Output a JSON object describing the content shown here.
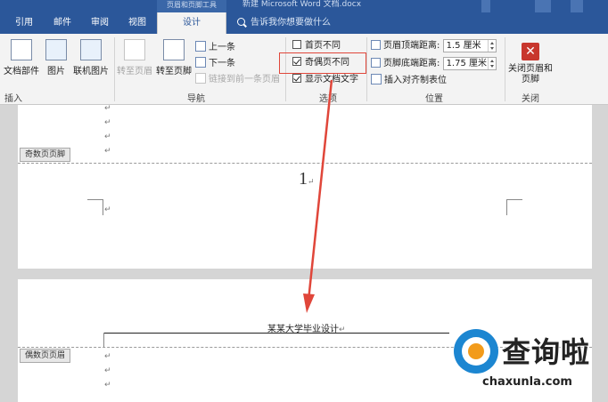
{
  "titlebar": {
    "context_group": "页眉和页脚工具",
    "doc_title": "新建 Microsoft Word 文档.docx",
    "tabs": [
      "引用",
      "邮件",
      "审阅",
      "视图",
      "设计"
    ],
    "active_tab": "设计",
    "tell_me": "告诉我你想要做什么"
  },
  "ribbon": {
    "insert": {
      "doc_parts": "文档部件",
      "picture": "图片",
      "online_picture": "联机图片",
      "label": "插入"
    },
    "nav": {
      "goto_header": "转至页眉",
      "goto_footer": "转至页脚",
      "previous": "上一条",
      "next": "下一条",
      "link_prev": "链接到前一条页眉",
      "label": "导航"
    },
    "options": {
      "diff_first": "首页不同",
      "diff_odd_even": "奇偶页不同",
      "show_doc_text": "显示文档文字",
      "label": "选项"
    },
    "position": {
      "header_top": "页眉顶端距离:",
      "header_top_value": "1.5 厘米",
      "footer_bottom": "页脚底端距离:",
      "footer_bottom_value": "1.75 厘米",
      "align_tab": "插入对齐制表位",
      "label": "位置"
    },
    "close": {
      "button": "关闭页眉和页脚",
      "label": "关闭"
    }
  },
  "document": {
    "para_mark": "↵",
    "odd_footer_tag": "奇数页页脚",
    "even_header_tag": "偶数页页眉",
    "page_number": "1",
    "header_text": "某某大学毕业设计"
  },
  "watermark": {
    "brand": "查询啦",
    "domain": "chaxunla.com"
  },
  "colors": {
    "title_blue": "#2b579a",
    "highlight_red": "#e0463a",
    "arrow_red": "#e0463a"
  }
}
